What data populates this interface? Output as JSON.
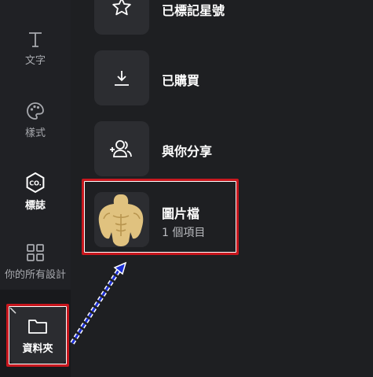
{
  "sidebar": {
    "items": [
      {
        "label": "文字",
        "icon": "text-icon"
      },
      {
        "label": "樣式",
        "icon": "palette-icon"
      },
      {
        "label": "標誌",
        "icon": "brand-logo-icon"
      },
      {
        "label": "你的所有設計",
        "icon": "grid-icon"
      },
      {
        "label": "資料夾",
        "icon": "folder-icon"
      }
    ]
  },
  "folders": [
    {
      "title": "已標記星號",
      "icon": "star-icon"
    },
    {
      "title": "已購買",
      "icon": "download-icon"
    },
    {
      "title": "與你分享",
      "icon": "share-people-icon"
    },
    {
      "title": "圖片檔",
      "subtitle": "1 個項目",
      "icon": "folder-thumbnail"
    }
  ],
  "brand_glyph": "CO.",
  "colors": {
    "highlight": "#c8171e",
    "arrow": "#1c2fd6",
    "background": "#1e1f22"
  }
}
